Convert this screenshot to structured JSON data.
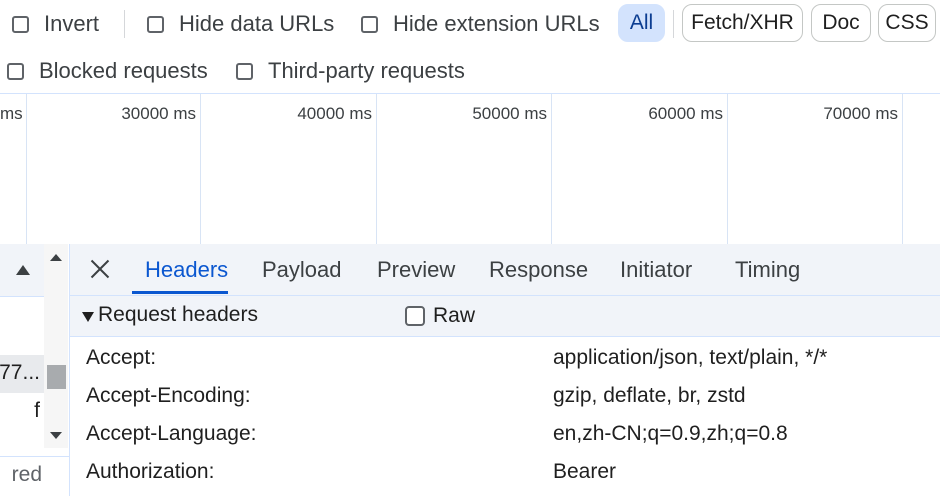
{
  "filters": {
    "invert": "Invert",
    "hide_data_urls": "Hide data URLs",
    "hide_extension_urls": "Hide extension URLs",
    "blocked_requests": "Blocked requests",
    "third_party_requests": "Third-party requests",
    "type_pills": [
      "All",
      "Fetch/XHR",
      "Doc",
      "CSS"
    ]
  },
  "timeline": {
    "ticks": [
      "ms",
      "30000 ms",
      "40000 ms",
      "50000 ms",
      "60000 ms",
      "70000 ms"
    ]
  },
  "request_list": {
    "rows": [
      "",
      "77...",
      "f"
    ],
    "footer": "red"
  },
  "detail": {
    "tabs": [
      "Headers",
      "Payload",
      "Preview",
      "Response",
      "Initiator",
      "Timing"
    ],
    "active_tab": "Headers",
    "section_title": "Request headers",
    "raw_label": "Raw",
    "headers": [
      {
        "name": "Accept:",
        "value": "application/json, text/plain, */*"
      },
      {
        "name": "Accept-Encoding:",
        "value": "gzip, deflate, br, zstd"
      },
      {
        "name": "Accept-Language:",
        "value": "en,zh-CN;q=0.9,zh;q=0.8"
      },
      {
        "name": "Authorization:",
        "value": "Bearer"
      }
    ]
  },
  "colors": {
    "accent": "#0b57d0",
    "active_pill_bg": "#d3e3fd",
    "panel_bg": "#f1f4f9",
    "divider": "#d3e3fd"
  }
}
